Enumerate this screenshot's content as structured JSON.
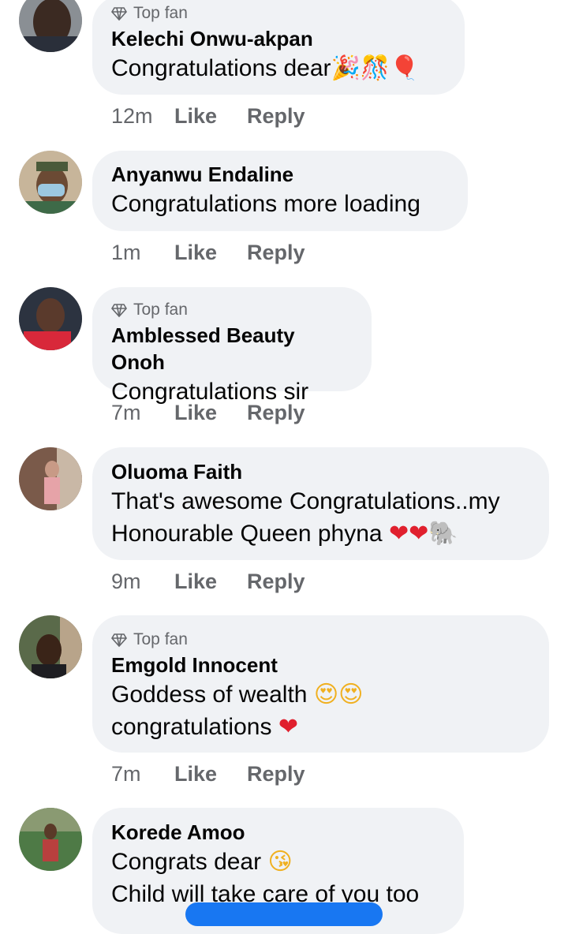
{
  "comments": [
    {
      "name": "Kelechi Onwu-akpan",
      "badge": "Top fan",
      "text_lines": [
        "Congratulations dear"
      ],
      "emoji_lines": [
        "🎉🎊🎈"
      ],
      "time": "12m",
      "like": "Like",
      "reply": "Reply"
    },
    {
      "name": "Anyanwu Endaline",
      "badge": "",
      "text_lines": [
        "Congratulations more loading"
      ],
      "emoji_lines": [
        ""
      ],
      "time": "1m",
      "like": "Like",
      "reply": "Reply"
    },
    {
      "name": "Amblessed Beauty Onoh",
      "badge": "Top fan",
      "text_lines": [
        "Congratulations sir"
      ],
      "emoji_lines": [
        ""
      ],
      "time": "7m",
      "like": "Like",
      "reply": "Reply"
    },
    {
      "name": "Oluoma Faith",
      "badge": "",
      "text_lines": [
        "That's awesome Congratulations..my",
        "Honourable Queen phyna "
      ],
      "emoji_lines": [
        "",
        "❤❤🐘"
      ],
      "time": "9m",
      "like": "Like",
      "reply": "Reply"
    },
    {
      "name": "Emgold Innocent",
      "badge": "Top fan",
      "text_lines": [
        "Goddess of wealth ",
        "congratulations "
      ],
      "emoji_lines": [
        "😍😍",
        "❤"
      ],
      "time": "7m",
      "like": "Like",
      "reply": "Reply"
    },
    {
      "name": "Korede Amoo",
      "badge": "",
      "text_lines": [
        "Congrats dear ",
        "Child will take care of you too"
      ],
      "emoji_lines": [
        "😘",
        ""
      ],
      "time": "",
      "like": "",
      "reply": ""
    }
  ],
  "icons": {
    "badge": "diamond-icon"
  },
  "colors": {
    "bubble": "#f0f2f5",
    "meta": "#65676b",
    "text": "#050505"
  }
}
